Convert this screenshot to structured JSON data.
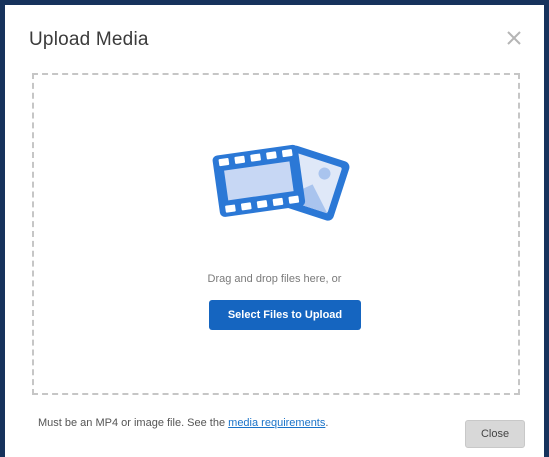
{
  "dialog": {
    "title": "Upload Media",
    "close_icon": "close-x-icon"
  },
  "dropzone": {
    "illustration": "film-and-image-icon",
    "instruction": "Drag and drop files here, or",
    "select_button_label": "Select Files to Upload"
  },
  "footer": {
    "note_prefix": "Must be an MP4 or image file. See the ",
    "note_link": "media requirements",
    "note_suffix": ".",
    "close_button_label": "Close"
  },
  "colors": {
    "frame_border": "#16325c",
    "primary_button": "#1565c0",
    "link": "#1a73c9",
    "illustration_blue": "#2b78d6"
  }
}
